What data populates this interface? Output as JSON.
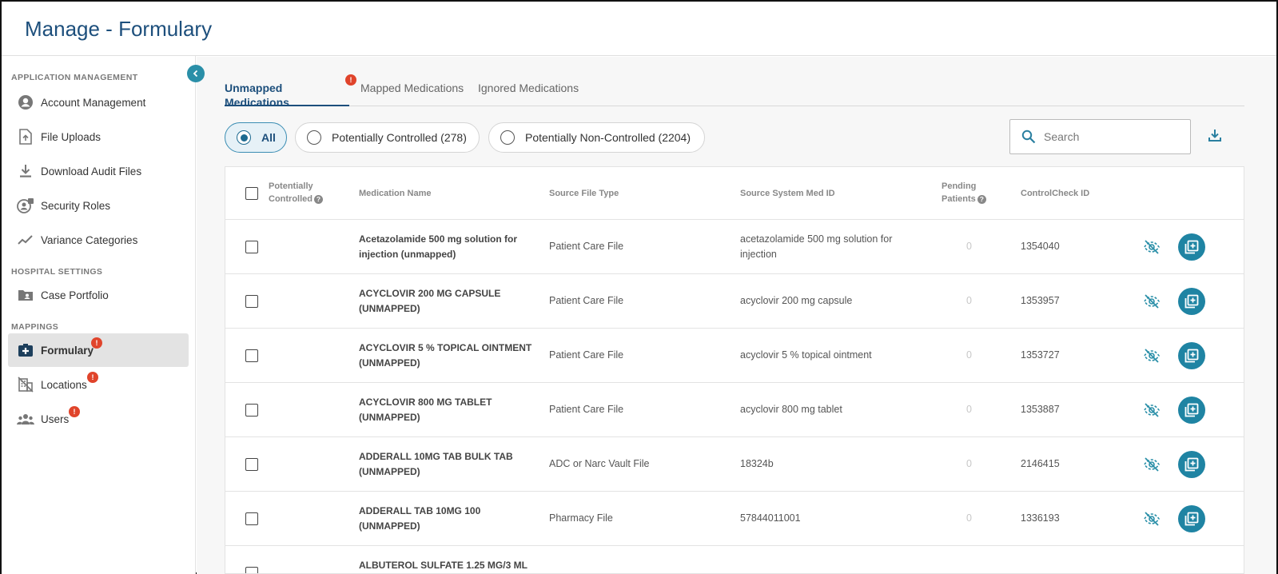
{
  "header": {
    "title": "Manage - Formulary"
  },
  "sidebar": {
    "sections": [
      {
        "title": "APPLICATION MANAGEMENT"
      },
      {
        "title": "HOSPITAL SETTINGS"
      },
      {
        "title": "MAPPINGS"
      }
    ],
    "items": [
      {
        "label": "Account Management",
        "icon": "account-icon"
      },
      {
        "label": "File Uploads",
        "icon": "file-upload-icon"
      },
      {
        "label": "Download Audit Files",
        "icon": "download-icon"
      },
      {
        "label": "Security Roles",
        "icon": "security-roles-icon"
      },
      {
        "label": "Variance Categories",
        "icon": "variance-icon"
      },
      {
        "label": "Case Portfolio",
        "icon": "case-portfolio-icon"
      },
      {
        "label": "Formulary",
        "icon": "formulary-icon",
        "badge": "!",
        "active": true
      },
      {
        "label": "Locations",
        "icon": "locations-icon",
        "badge": "!"
      },
      {
        "label": "Users",
        "icon": "users-icon",
        "badge": "!"
      }
    ]
  },
  "tabs": [
    {
      "label": "Unmapped Medications",
      "badge": "!",
      "active": true
    },
    {
      "label": "Mapped Medications"
    },
    {
      "label": "Ignored Medications"
    }
  ],
  "filters": [
    {
      "label": "All",
      "selected": true
    },
    {
      "label": "Potentially Controlled (278)"
    },
    {
      "label": "Potentially Non-Controlled (2204)"
    }
  ],
  "search": {
    "placeholder": "Search",
    "value": ""
  },
  "table": {
    "headers": {
      "controlled_line1": "Potentially",
      "controlled_line2": "Controlled",
      "name": "Medication Name",
      "source_type": "Source File Type",
      "source_id": "Source System Med ID",
      "pending_line1": "Pending",
      "pending_line2": "Patients",
      "controlcheck": "ControlCheck ID"
    },
    "rows": [
      {
        "name_1": "Acetazolamide 500 mg solution for",
        "name_2": "injection (unmapped)",
        "source_type": "Patient Care File",
        "source_id_1": "acetazolamide 500 mg solution for",
        "source_id_2": "injection",
        "pending": "0",
        "controlcheck": "1354040"
      },
      {
        "name_1": "ACYCLOVIR 200 MG CAPSULE",
        "name_2": "(UNMAPPED)",
        "source_type": "Patient Care File",
        "source_id_1": "acyclovir 200 mg capsule",
        "source_id_2": "",
        "pending": "0",
        "controlcheck": "1353957"
      },
      {
        "name_1": "ACYCLOVIR 5 % TOPICAL OINTMENT",
        "name_2": "(UNMAPPED)",
        "source_type": "Patient Care File",
        "source_id_1": "acyclovir 5 % topical ointment",
        "source_id_2": "",
        "pending": "0",
        "controlcheck": "1353727"
      },
      {
        "name_1": "ACYCLOVIR 800 MG TABLET",
        "name_2": "(UNMAPPED)",
        "source_type": "Patient Care File",
        "source_id_1": "acyclovir 800 mg tablet",
        "source_id_2": "",
        "pending": "0",
        "controlcheck": "1353887"
      },
      {
        "name_1": "ADDERALL 10MG TAB BULK TAB",
        "name_2": "(UNMAPPED)",
        "source_type": "ADC or Narc Vault File",
        "source_id_1": "18324b",
        "source_id_2": "",
        "pending": "0",
        "controlcheck": "2146415"
      },
      {
        "name_1": "ADDERALL TAB 10MG 100",
        "name_2": "(UNMAPPED)",
        "source_type": "Pharmacy File",
        "source_id_1": "57844011001",
        "source_id_2": "",
        "pending": "0",
        "controlcheck": "1336193"
      },
      {
        "name_1": "ALBUTEROL SULFATE 1.25 MG/3 ML",
        "name_2": "",
        "source_type": "",
        "source_id_1": "",
        "source_id_2": "",
        "pending": "",
        "controlcheck": ""
      }
    ]
  }
}
